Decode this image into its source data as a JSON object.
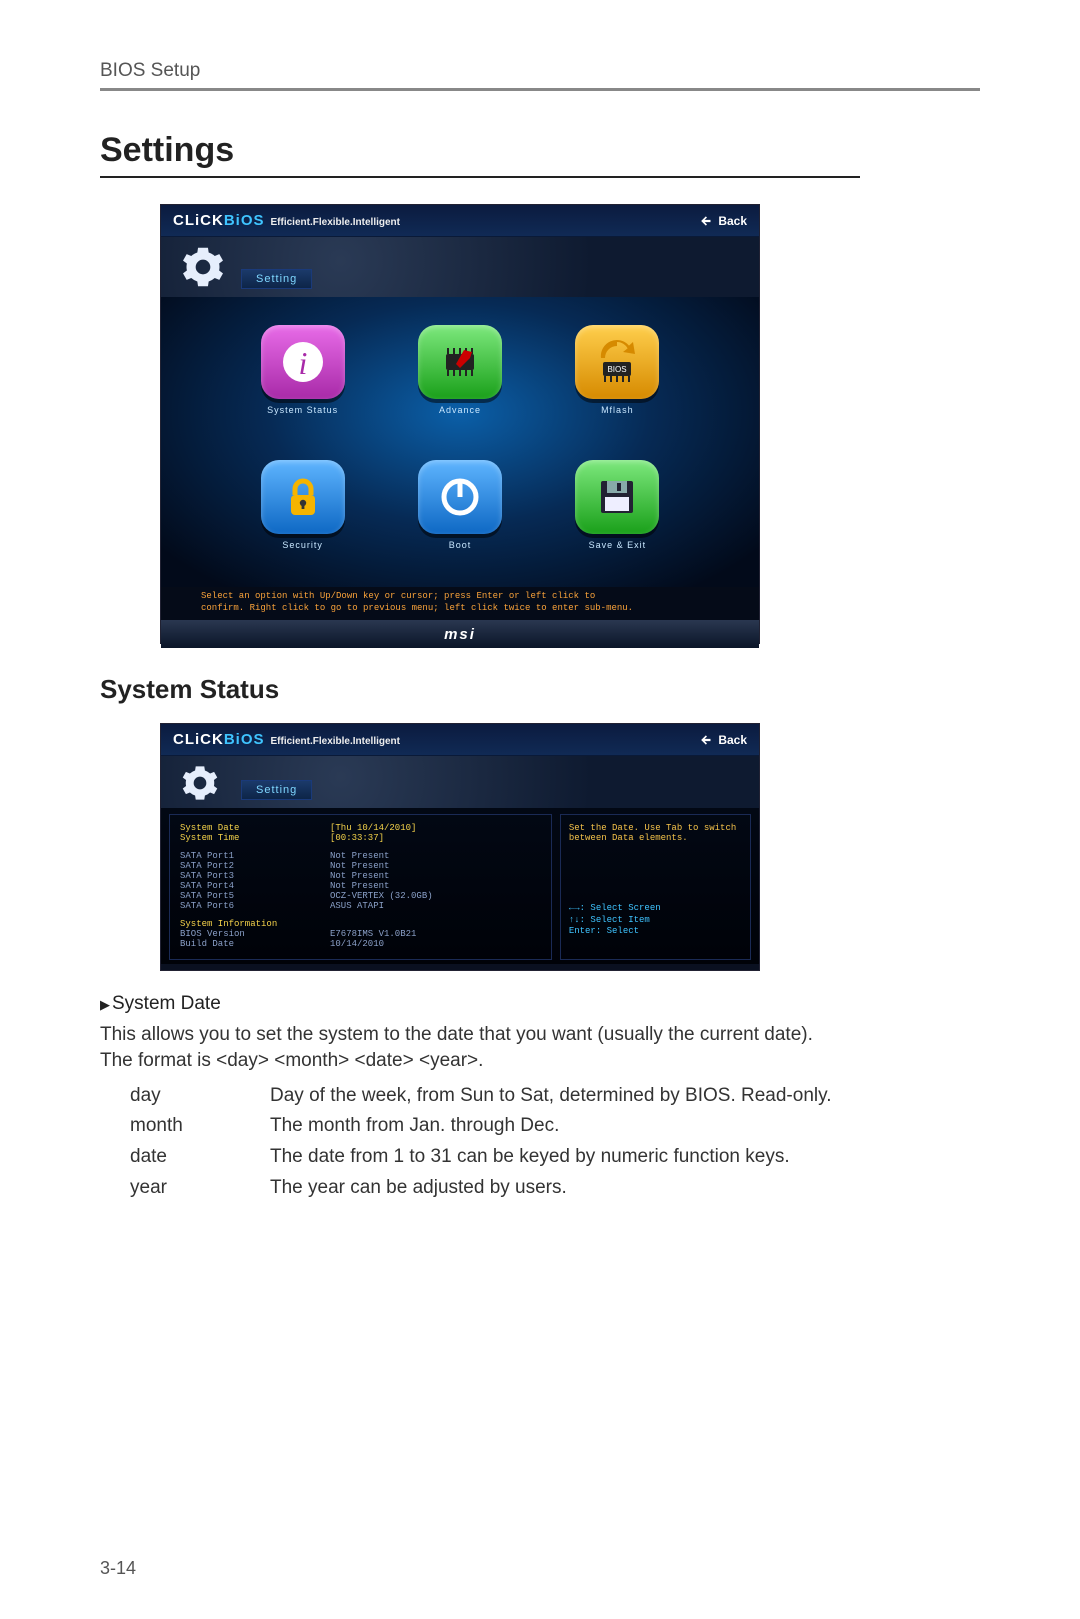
{
  "doc": {
    "header": "BIOS Setup",
    "h1": "Settings",
    "h2": "System Status",
    "page_number": "3-14"
  },
  "bios_common": {
    "logo_a": "CLiCK",
    "logo_b": "BiOS",
    "tagline": "Efficient.Flexible.Intelligent",
    "back": "Back",
    "setting_label": "Setting",
    "msi": "msi"
  },
  "cap1": {
    "tiles": [
      {
        "label": "System Status",
        "name": "tile-system-status"
      },
      {
        "label": "Advance",
        "name": "tile-advance"
      },
      {
        "label": "Mflash",
        "name": "tile-mflash"
      },
      {
        "label": "Security",
        "name": "tile-security"
      },
      {
        "label": "Boot",
        "name": "tile-boot"
      },
      {
        "label": "Save & Exit",
        "name": "tile-save-exit"
      }
    ],
    "help1": "Select an option with Up/Down key or cursor; press Enter or left click to",
    "help2": "confirm. Right click to go to previous menu; left click twice to enter sub-menu."
  },
  "cap2": {
    "left_rows": [
      {
        "cls": "yellow",
        "k": "System Date",
        "v": "[Thu 10/14/2010]"
      },
      {
        "cls": "yellow",
        "k": "System Time",
        "v": "[00:33:37]"
      },
      {
        "cls": "spacer"
      },
      {
        "cls": "grey",
        "k": "SATA Port1",
        "v": "Not Present"
      },
      {
        "cls": "grey",
        "k": "SATA Port2",
        "v": "Not Present"
      },
      {
        "cls": "grey",
        "k": "SATA Port3",
        "v": "Not Present"
      },
      {
        "cls": "grey",
        "k": "SATA Port4",
        "v": "Not Present"
      },
      {
        "cls": "grey",
        "k": "SATA Port5",
        "v": "OCZ-VERTEX (32.0GB)"
      },
      {
        "cls": "grey",
        "k": "SATA Port6",
        "v": "ASUS ATAPI"
      },
      {
        "cls": "spacer"
      },
      {
        "cls": "yellow",
        "k": "System Information",
        "v": ""
      },
      {
        "cls": "grey",
        "k": "BIOS Version",
        "v": "E7678IMS V1.0B21"
      },
      {
        "cls": "grey",
        "k": "Build Date",
        "v": "10/14/2010"
      }
    ],
    "right_help1": "Set the Date. Use Tab to switch",
    "right_help2": "between Data elements.",
    "nav1": "←→: Select Screen",
    "nav2": "↑↓: Select Item",
    "nav3": "Enter: Select"
  },
  "text": {
    "sub": "System Date",
    "p1": "This allows you to set the system to the date that you want (usually the current date).",
    "p2": "The format is <day> <month> <date> <year>.",
    "defs": [
      {
        "term": "day",
        "desc": "Day of the week, from Sun to Sat, determined by BIOS. Read-only."
      },
      {
        "term": "month",
        "desc": "The month from Jan. through Dec."
      },
      {
        "term": "date",
        "desc": "The date from 1 to 31 can be keyed by numeric function keys."
      },
      {
        "term": "year",
        "desc": "The year can be adjusted by users."
      }
    ]
  }
}
